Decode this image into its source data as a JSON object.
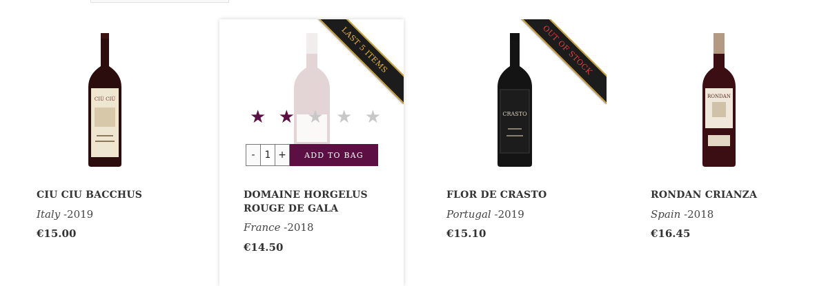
{
  "products": [
    {
      "name": "CIU CIU BACCHUS",
      "country": "Italy",
      "year": "-2019",
      "price": "€15.00",
      "label_text": "CIÙ CIÙ"
    },
    {
      "name": "DOMAINE HORGELUS ROUGE DE GALA",
      "country": "France",
      "year": "-2018",
      "price": "€14.50",
      "ribbon": "LAST 5 ITEMS",
      "rating": 2,
      "rating_max": 5,
      "quantity": "1",
      "minus_label": "-",
      "plus_label": "+",
      "add_label": "ADD TO BAG"
    },
    {
      "name": "FLOR DE CRASTO",
      "country": "Portugal",
      "year": "-2019",
      "price": "€15.10",
      "ribbon": "OUT OF STOCK",
      "label_text": "CRASTO"
    },
    {
      "name": "RONDAN CRIANZA",
      "country": "Spain",
      "year": "-2018",
      "price": "€16.45",
      "label_text": "RONDAN"
    }
  ],
  "colors": {
    "accent": "#5b0f43",
    "ribbon_gold_text": "#e8b63a",
    "ribbon_red_text": "#e0413f",
    "star_off": "#c8c8c8"
  }
}
